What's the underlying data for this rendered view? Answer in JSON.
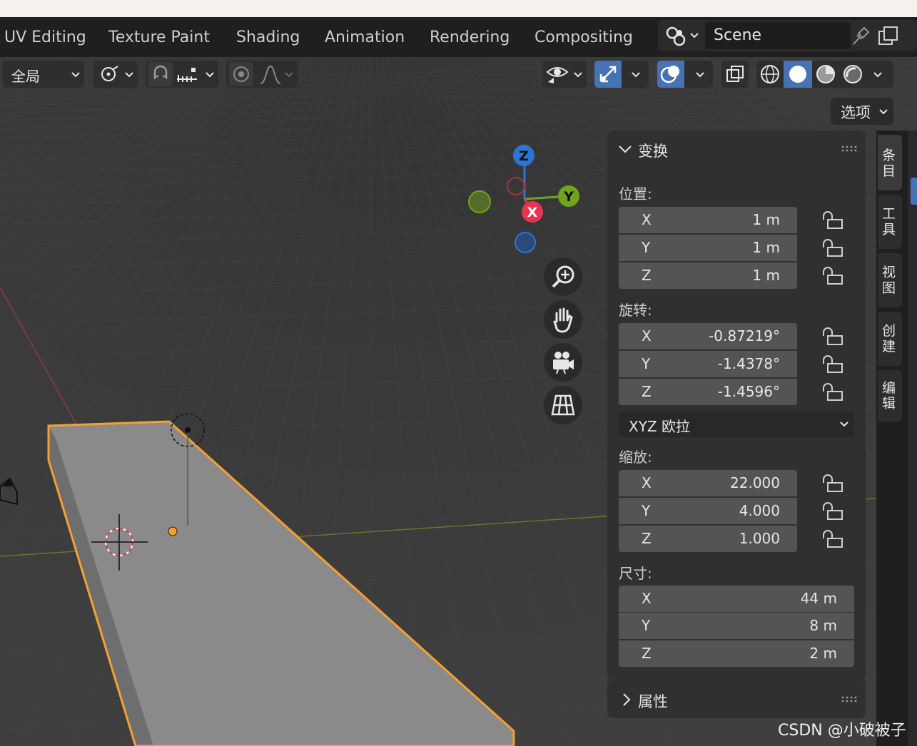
{
  "workspace_tabs": [
    "UV Editing",
    "Texture Paint",
    "Shading",
    "Animation",
    "Rendering",
    "Compositing"
  ],
  "scene": {
    "name": "Scene",
    "icon": "scene-icon",
    "pin_icon": "pin-icon",
    "copy_icon": "copy-icon"
  },
  "header": {
    "orientation_label": "全局",
    "options_label": "选项"
  },
  "gizmo": {
    "z": "Z",
    "y": "Y",
    "x": "X"
  },
  "nav_icons": [
    "zoom-icon",
    "hand-pan-icon",
    "camera-icon",
    "perspective-grid-icon"
  ],
  "transform_panel": {
    "title": "变换",
    "location": {
      "label": "位置:",
      "rows": [
        {
          "axis": "X",
          "value": "1 m"
        },
        {
          "axis": "Y",
          "value": "1 m"
        },
        {
          "axis": "Z",
          "value": "1 m"
        }
      ]
    },
    "rotation": {
      "label": "旋转:",
      "rows": [
        {
          "axis": "X",
          "value": "-0.87219°"
        },
        {
          "axis": "Y",
          "value": "-1.4378°"
        },
        {
          "axis": "Z",
          "value": "-1.4596°"
        }
      ]
    },
    "rotation_mode": "XYZ 欧拉",
    "scale": {
      "label": "缩放:",
      "rows": [
        {
          "axis": "X",
          "value": "22.000"
        },
        {
          "axis": "Y",
          "value": "4.000"
        },
        {
          "axis": "Z",
          "value": "1.000"
        }
      ]
    },
    "dimensions": {
      "label": "尺寸:",
      "rows": [
        {
          "axis": "X",
          "value": "44 m"
        },
        {
          "axis": "Y",
          "value": "8 m"
        },
        {
          "axis": "Z",
          "value": "2 m"
        }
      ]
    }
  },
  "properties_panel": {
    "title": "属性"
  },
  "side_tabs": [
    "条目",
    "工具",
    "视图",
    "创建",
    "编辑"
  ],
  "watermark": "CSDN @小破被子",
  "colors": {
    "accent_blue": "#4772b3",
    "selection_orange": "#f5a030",
    "axis_x": "#e8344e",
    "axis_y": "#6ea51c",
    "axis_z": "#2d74d6"
  }
}
